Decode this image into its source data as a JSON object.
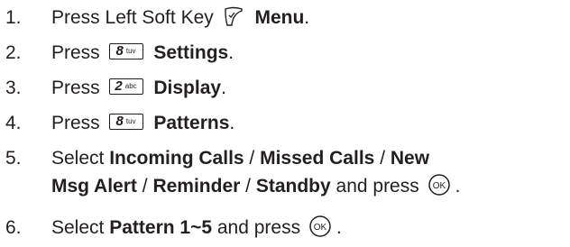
{
  "steps": [
    {
      "num": "1.",
      "press": "Press Left Soft Key",
      "target": "Menu",
      "end": "."
    },
    {
      "num": "2.",
      "press": "Press",
      "key_digit": "8",
      "key_letters": "tuv",
      "target": "Settings",
      "end": "."
    },
    {
      "num": "3.",
      "press": "Press",
      "key_digit": "2",
      "key_letters": "abc",
      "target": "Display",
      "end": "."
    },
    {
      "num": "4.",
      "press": "Press",
      "key_digit": "8",
      "key_letters": "tuv",
      "target": "Patterns",
      "end": "."
    },
    {
      "num": "5.",
      "select": "Select",
      "opt1": "Incoming Calls",
      "sep": "/",
      "opt2": "Missed Calls",
      "opt3a": "New",
      "opt3b": "Msg Alert",
      "opt4": "Reminder",
      "opt5": "Standby",
      "and_press": "and press",
      "end": "."
    },
    {
      "num": "6.",
      "select": "Select",
      "target": "Pattern 1~5",
      "and_press": "and press",
      "end": "."
    }
  ],
  "ok_key_label": "OK",
  "icons": {
    "left_soft_key": "left-soft-key-icon",
    "ok_key": "ok-key-icon",
    "number_key": "number-key-icon"
  }
}
